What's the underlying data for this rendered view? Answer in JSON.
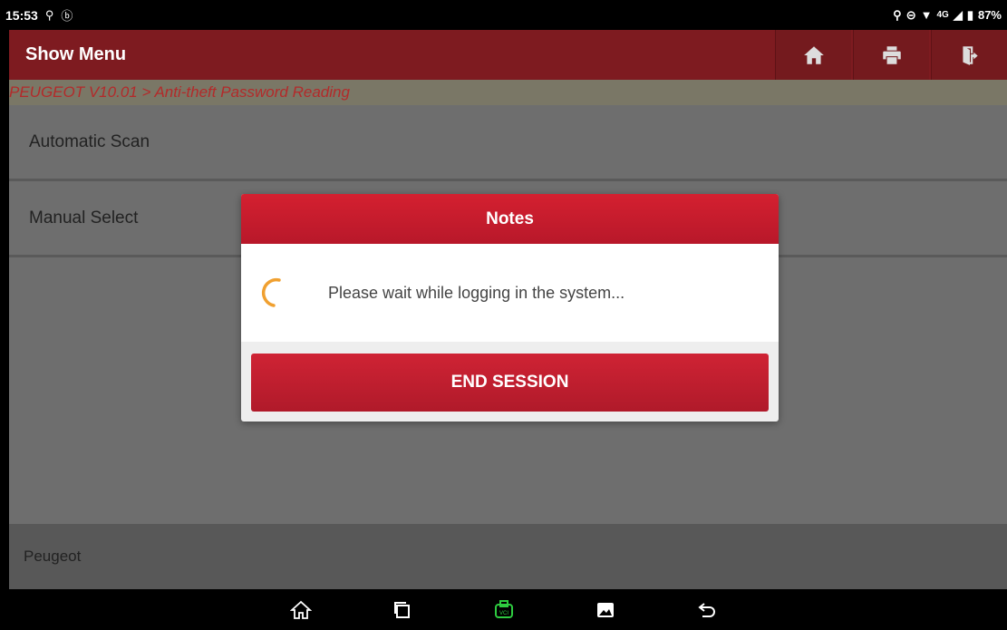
{
  "status_bar": {
    "time": "15:53",
    "left_icons": [
      "usb-debug-icon",
      "bluetooth-circle-icon"
    ],
    "right_icons": [
      "location-icon",
      "dnd-icon",
      "wifi-icon",
      "signal-icon",
      "battery-icon"
    ],
    "network": "4G",
    "battery": "87%"
  },
  "header": {
    "title": "Show Menu",
    "buttons": [
      "home-icon",
      "print-icon",
      "exit-icon"
    ]
  },
  "breadcrumb": "PEUGEOT V10.01 > Anti-theft Password Reading",
  "menu": {
    "items": [
      {
        "label": "Automatic Scan"
      },
      {
        "label": "Manual Select"
      }
    ]
  },
  "footer": {
    "label": "Peugeot"
  },
  "dialog": {
    "title": "Notes",
    "message": "Please wait while logging in the system...",
    "button": "END SESSION"
  },
  "nav_bar": {
    "icons": [
      "home-outline-icon",
      "recents-icon",
      "vci-icon",
      "gallery-icon",
      "back-icon"
    ]
  },
  "colors": {
    "header_bg": "#7e1b20",
    "accent_red": "#c41e2e",
    "spinner": "#f0a030",
    "vci_green": "#2ecc40"
  }
}
